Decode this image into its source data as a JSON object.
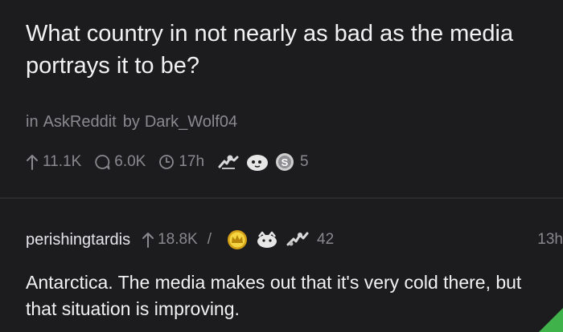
{
  "post": {
    "title": "What country in not nearly as bad as the media portrays it to be?",
    "in_label": "in",
    "subreddit": "AskReddit",
    "by_label": "by",
    "author": "Dark_Wolf04",
    "upvotes": "11.1K",
    "comments": "6.0K",
    "age": "17h",
    "awards": [
      "arm-wrestling-award",
      "ghost-award",
      "silver-award"
    ],
    "award_count": "5"
  },
  "comment": {
    "username": "perishingtardis",
    "score": "18.8K",
    "awards": [
      "gold-crown-award",
      "wholesome-award",
      "helpful-award"
    ],
    "award_count": "42",
    "age": "13h",
    "body": "Antarctica. The media makes out that it's very cold there, but that situation is improving."
  },
  "colors": {
    "background": "#1c1c1e",
    "text_primary": "#f2f2f2",
    "text_secondary": "#8a8a8e",
    "accent_green": "#3fb24a"
  }
}
